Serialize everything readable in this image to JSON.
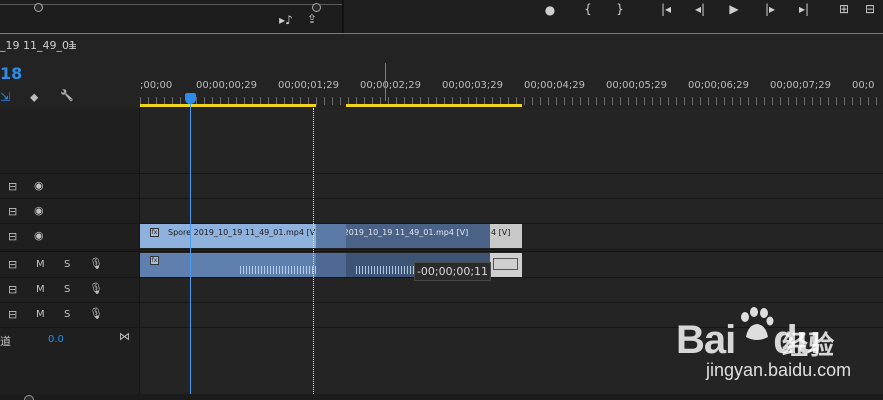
{
  "source_monitor": {
    "controls": [
      "export-frame-icon",
      "insert-icon"
    ],
    "control_glyphs": [
      "▸♪",
      "⇪"
    ]
  },
  "program_monitor": {
    "controls": [
      {
        "name": "marker-icon",
        "glyph": "●"
      },
      {
        "name": "mark-in-icon",
        "glyph": "{"
      },
      {
        "name": "mark-out-icon",
        "glyph": "}"
      },
      {
        "name": "go-to-in-icon",
        "glyph": "|◂"
      },
      {
        "name": "step-back-icon",
        "glyph": "◂|"
      },
      {
        "name": "play-icon",
        "glyph": "▶"
      },
      {
        "name": "step-forward-icon",
        "glyph": "|▸"
      },
      {
        "name": "go-to-out-icon",
        "glyph": "▸|"
      },
      {
        "name": "lift-icon",
        "glyph": "⊞"
      },
      {
        "name": "extract-icon",
        "glyph": "⊟"
      }
    ]
  },
  "sequence": {
    "tab_label": "_19 11_49_01",
    "menu_glyph": "≡",
    "timecode": "18"
  },
  "timeline_controls": [
    {
      "name": "linked-selection-icon",
      "glyph": "⇲"
    },
    {
      "name": "add-marker-icon",
      "glyph": "⬥"
    },
    {
      "name": "settings-wrench-icon",
      "glyph": "🔧"
    }
  ],
  "ruler": {
    "labels": [
      ";00;00",
      "00;00;00;29",
      "00;00;01;29",
      "00;00;02;29",
      "00;00;03;29",
      "00;00;04;29",
      "00;00;05;29",
      "00;00;06;29",
      "00;00;07;29",
      "00;0"
    ]
  },
  "tracks": {
    "video": [
      {
        "row": 1
      },
      {
        "row": 2
      },
      {
        "row": 3
      }
    ],
    "audio": [
      {
        "m": "M",
        "s": "S"
      },
      {
        "m": "M",
        "s": "S"
      },
      {
        "m": "M",
        "s": "S"
      }
    ],
    "master": {
      "label": "道",
      "value": "0.0"
    }
  },
  "clips": {
    "v1_a": "Spore 2019_10_19 11_49_01.mp4 [V]",
    "v1_b": "Spore 2019_10_19 11_49_01.mp4 [V]",
    "v1_c": "4 [V]",
    "fx": "fx"
  },
  "tooltip": "-00;00;00;11",
  "watermark": {
    "logo": "Bai",
    "logo_tail": "du",
    "cn": "经验",
    "url": "jingyan.baidu.com"
  }
}
